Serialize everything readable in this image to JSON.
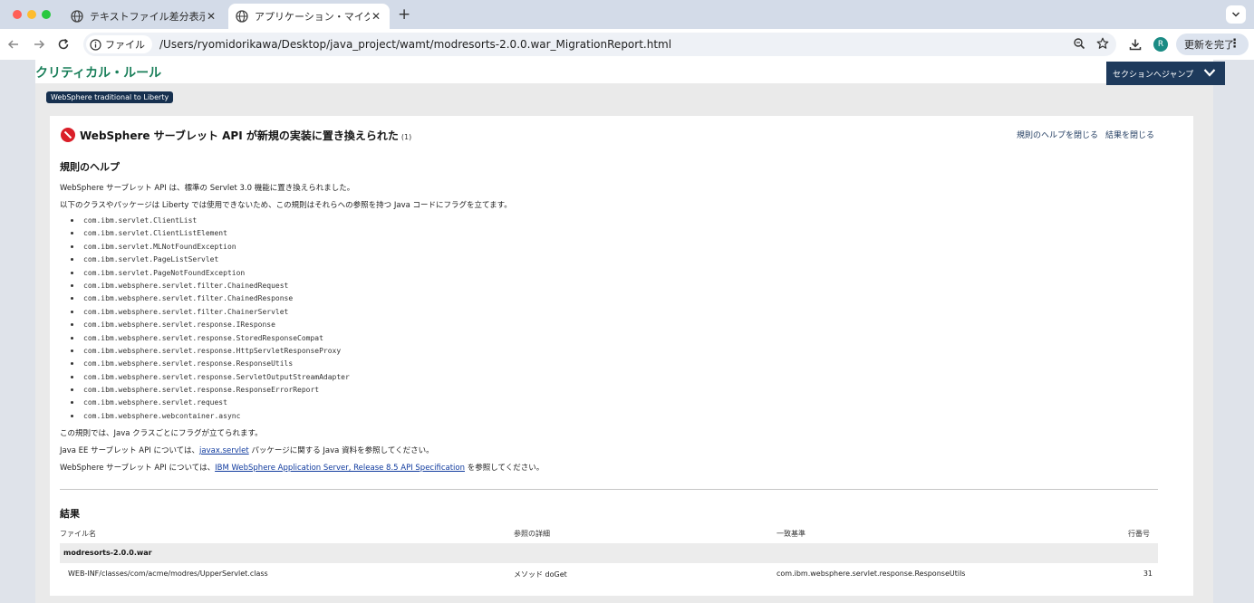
{
  "browser": {
    "tabs": [
      {
        "label": "テキストファイル差分表示結果",
        "active": false
      },
      {
        "label": "アプリケーション・マイグレーシ",
        "active": true
      }
    ],
    "address": {
      "scheme_chip": "ファイル",
      "url": "/Users/ryomidorikawa/Desktop/java_project/wamt/modresorts-2.0.0.war_MigrationReport.html"
    },
    "profile_initial": "R",
    "update_label": "更新を完了"
  },
  "section": {
    "title": "クリティカル・ルール",
    "jump_label": "セクションへジャンプ",
    "tag": "WebSphere traditional to Liberty"
  },
  "rule": {
    "title": "WebSphere サーブレット API が新規の実装に置き換えられた",
    "count": "(1)",
    "close_help_label": "規則のヘルプを閉じる",
    "close_results_label": "結果を閉じる",
    "help_heading": "規則のヘルプ",
    "intro_1": "WebSphere サーブレット API は、標準の Servlet 3.0 機能に置き換えられました。",
    "intro_2": "以下のクラスやパッケージは Liberty では使用できないため、この規則はそれらへの参照を持つ Java コードにフラグを立てます。",
    "classes": [
      "com.ibm.servlet.ClientList",
      "com.ibm.servlet.ClientListElement",
      "com.ibm.servlet.MLNotFoundException",
      "com.ibm.servlet.PageListServlet",
      "com.ibm.servlet.PageNotFoundException",
      "com.ibm.websphere.servlet.filter.ChainedRequest",
      "com.ibm.websphere.servlet.filter.ChainedResponse",
      "com.ibm.websphere.servlet.filter.ChainerServlet",
      "com.ibm.websphere.servlet.response.IResponse",
      "com.ibm.websphere.servlet.response.StoredResponseCompat",
      "com.ibm.websphere.servlet.response.HttpServletResponseProxy",
      "com.ibm.websphere.servlet.response.ResponseUtils",
      "com.ibm.websphere.servlet.response.ServletOutputStreamAdapter",
      "com.ibm.websphere.servlet.response.ResponseErrorReport",
      "com.ibm.websphere.servlet.request",
      "com.ibm.websphere.webcontainer.async"
    ],
    "flag_note": "この規則では、Java クラスごとにフラグが立てられます。",
    "javaee_prefix": "Java EE サーブレット API については、",
    "javaee_link": "javax.servlet",
    "javaee_suffix": " パッケージに関する Java 資料を参照してください。",
    "was_prefix": "WebSphere サーブレット API については、",
    "was_link": "IBM WebSphere Application Server, Release 8.5 API Specification",
    "was_suffix": " を参照してください。"
  },
  "results": {
    "heading": "結果",
    "columns": {
      "file": "ファイル名",
      "detail": "参照の詳細",
      "match": "一致基準",
      "line": "行番号"
    },
    "group": "modresorts-2.0.0.war",
    "rows": [
      {
        "file": "WEB-INF/classes/com/acme/modres/UpperServlet.class",
        "detail": "メソッド doGet",
        "match": "com.ibm.websphere.servlet.response.ResponseUtils",
        "line": "31"
      }
    ]
  }
}
